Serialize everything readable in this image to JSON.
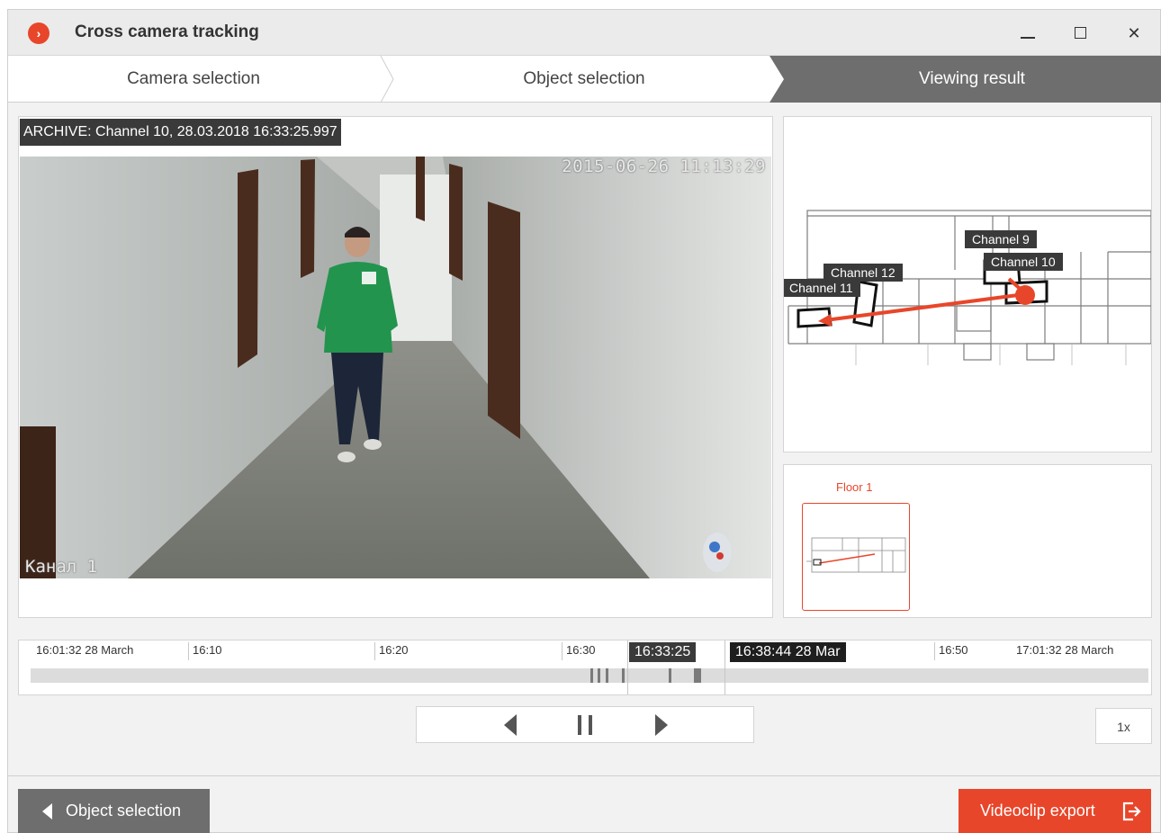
{
  "window": {
    "title": "Cross camera tracking",
    "accent_color": "#e8462a"
  },
  "steps": [
    {
      "label": "Camera selection"
    },
    {
      "label": "Object selection"
    },
    {
      "label": "Viewing result"
    }
  ],
  "video": {
    "archive_label": "ARCHIVE: Channel 10, 28.03.2018 16:33:25.997",
    "osd_timestamp": "2015-06-26 11:13:29",
    "osd_channel": "Канал 1"
  },
  "map": {
    "channels": [
      "Channel 9",
      "Channel 10",
      "Channel 12",
      "Channel 11"
    ]
  },
  "floors": {
    "label": "Floor 1"
  },
  "timeline": {
    "ticks": [
      "16:01:32 28 March",
      "16:10",
      "16:20",
      "16:30",
      "16:50",
      "17:01:32 28 March"
    ],
    "current_time": "16:33:25",
    "selected_time": "16:38:44 28 Mar"
  },
  "transport": {
    "speed": "1x",
    "icons": [
      "step-back-icon",
      "pause-icon",
      "step-forward-icon"
    ]
  },
  "footer": {
    "back_label": "Object selection",
    "export_label": "Videoclip export"
  }
}
